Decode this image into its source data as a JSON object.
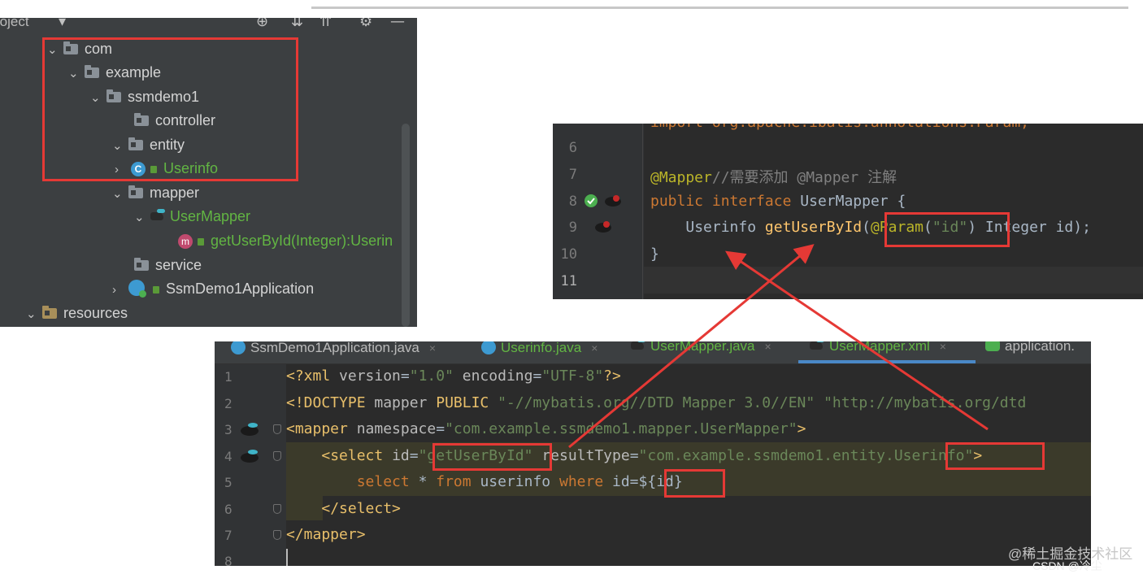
{
  "project_panel": {
    "title": "roject",
    "tree": [
      {
        "label": "com",
        "type": "package"
      },
      {
        "label": "example",
        "type": "package"
      },
      {
        "label": "ssmdemo1",
        "type": "package"
      },
      {
        "label": "controller",
        "type": "package"
      },
      {
        "label": "entity",
        "type": "package"
      },
      {
        "label": "Userinfo",
        "type": "class"
      },
      {
        "label": "mapper",
        "type": "package"
      },
      {
        "label": "UserMapper",
        "type": "interface"
      },
      {
        "label": "getUserById(Integer):Userin",
        "type": "method"
      },
      {
        "label": "service",
        "type": "package"
      },
      {
        "label": "SsmDemo1Application",
        "type": "class"
      },
      {
        "label": "resources",
        "type": "folder"
      }
    ],
    "class_badge": "C",
    "method_badge": "m"
  },
  "java_editor": {
    "line_numbers": [
      "6",
      "7",
      "8",
      "9",
      "10",
      "11"
    ],
    "import_line": "import org.apache.ibatis.annotations.Param;",
    "annotation": "@Mapper",
    "comment": "//需要添加 @Mapper 注解",
    "kw_public": "public",
    "kw_interface": "interface",
    "interface_name": "UserMapper",
    "open_brace": "{",
    "return_type": "Userinfo",
    "method_name": "getUserById",
    "open_paren": "(",
    "param_annotation": "@Param",
    "param_paren_open": "(",
    "param_value": "\"id\"",
    "param_paren_close": ")",
    "param_type": "Integer",
    "param_rest": "id);",
    "close_brace": "}"
  },
  "xml_editor": {
    "tabs": [
      {
        "label": "SsmDemo1Application.java",
        "close": "×"
      },
      {
        "label": "Userinfo.java",
        "close": "×"
      },
      {
        "label": "UserMapper.java",
        "close": "×"
      },
      {
        "label": "UserMapper.xml",
        "close": "×"
      },
      {
        "label": "application.",
        "close": ""
      }
    ],
    "line_numbers": [
      "1",
      "2",
      "3",
      "4",
      "5",
      "6",
      "7",
      "8"
    ],
    "l1_open": "<?xml ",
    "l1_a1": "version",
    "l1_eq1": "=",
    "l1_v1": "\"1.0\"",
    "l1_a2": " encoding",
    "l1_eq2": "=",
    "l1_v2": "\"UTF-8\"",
    "l1_close": "?>",
    "l2_open": "<!DOCTYPE ",
    "l2_rest": "mapper ",
    "l2_kw": "PUBLIC ",
    "l2_s1": "\"-//mybatis.org//DTD Mapper 3.0//EN\"",
    "l2_s2": " \"http://mybatis.org/dtd",
    "l3_tag": "<mapper ",
    "l3_attr": "namespace",
    "l3_eq": "=",
    "l3_val": "\"com.example.ssmdemo1.mapper.UserMapper\"",
    "l3_close": ">",
    "l4_tag": "<select ",
    "l4_attr": "id",
    "l4_eq": "=",
    "l4_val": "\"getUserById\"",
    "l4_attr2": " resultType",
    "l4_eq2": "=",
    "l4_val2_a": "\"com.example.ssmdemo1.entity.",
    "l4_val2_b": "Userinfo\"",
    "l4_close": ">",
    "l5_kw1": "select",
    "l5_star": " * ",
    "l5_kw2": "from",
    "l5_tbl": " userinfo ",
    "l5_kw3": "where",
    "l5_col": " id=",
    "l5_param": "${id}",
    "l6": "</select>",
    "l7": "</mapper>"
  },
  "watermark": {
    "line1": "@稀土掘金技术社区",
    "line2": "CSDN @冷尘"
  },
  "colors": {
    "highlight_red": "#e53935",
    "ide_bg": "#2b2b2b",
    "panel_bg": "#3c3f41",
    "keyword": "#cc7832",
    "string": "#6a8759",
    "annotation": "#bbb529"
  }
}
